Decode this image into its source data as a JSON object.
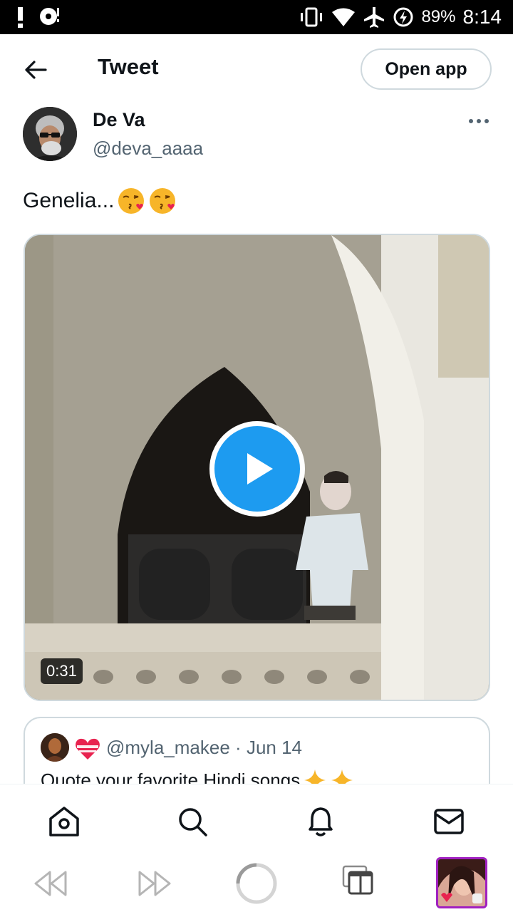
{
  "status_bar": {
    "battery": "89%",
    "time": "8:14",
    "icons": [
      "alert-icon",
      "media-icon",
      "vibrate-icon",
      "wifi-icon",
      "airplane-icon",
      "battery-charging-icon"
    ]
  },
  "header": {
    "title": "Tweet",
    "back_icon": "arrow-left-icon",
    "open_app_label": "Open app"
  },
  "tweet": {
    "author": {
      "name": "De Va",
      "handle": "@deva_aaaa"
    },
    "text": "Genelia...",
    "emojis": [
      "kissing-face-emoji",
      "kissing-face-emoji"
    ],
    "media": {
      "type": "video",
      "duration": "0:31"
    }
  },
  "quote": {
    "handle": "@myla_makee",
    "separator": "·",
    "date": "Jun 14",
    "text": "Quote your favorite Hindi songs",
    "emojis": [
      "sparkles-emoji",
      "sparkles-emoji"
    ]
  },
  "tabbar": {
    "items": [
      "home-icon",
      "search-icon",
      "notifications-icon",
      "messages-icon"
    ]
  },
  "browser": {
    "items": [
      "back-icon",
      "forward-icon",
      "reload-icon",
      "tabs-icon",
      "tab-thumbnail"
    ]
  },
  "colors": {
    "accent": "#1d9bf0",
    "text": "#0f1419",
    "secondary": "#536471",
    "border": "#cfd9de",
    "thumbnail_border": "#a020c0"
  }
}
